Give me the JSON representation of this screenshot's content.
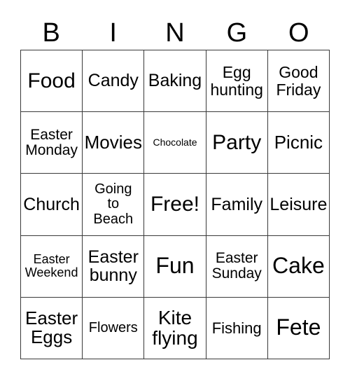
{
  "card": {
    "background_color": "#ffffff",
    "text_color": "#000000",
    "border_color": "#3a3a3a",
    "columns": 5,
    "rows": 5
  },
  "header": {
    "letters": [
      "B",
      "I",
      "N",
      "G",
      "O"
    ]
  },
  "grid": {
    "rows": [
      [
        {
          "text": "Food",
          "size": "fs-30"
        },
        {
          "text": "Candy",
          "size": "fs-25"
        },
        {
          "text": "Baking",
          "size": "fs-25"
        },
        {
          "text": "Egg\nhunting",
          "size": "fs-23"
        },
        {
          "text": "Good\nFriday",
          "size": "fs-23"
        }
      ],
      [
        {
          "text": "Easter\nMonday",
          "size": "fs-21"
        },
        {
          "text": "Movies",
          "size": "fs-26"
        },
        {
          "text": "Chocolate",
          "size": "fs-14"
        },
        {
          "text": "Party",
          "size": "fs-30"
        },
        {
          "text": "Picnic",
          "size": "fs-26"
        }
      ],
      [
        {
          "text": "Church",
          "size": "fs-25"
        },
        {
          "text": "Going\nto\nBeach",
          "size": "fs-20"
        },
        {
          "text": "Free!",
          "size": "fs-30"
        },
        {
          "text": "Family",
          "size": "fs-25"
        },
        {
          "text": "Leisure",
          "size": "fs-25"
        }
      ],
      [
        {
          "text": "Easter\nWeekend",
          "size": "fs-18"
        },
        {
          "text": "Easter\nbunny",
          "size": "fs-25"
        },
        {
          "text": "Fun",
          "size": "fs-32"
        },
        {
          "text": "Easter\nSunday",
          "size": "fs-21"
        },
        {
          "text": "Cake",
          "size": "fs-32"
        }
      ],
      [
        {
          "text": "Easter\nEggs",
          "size": "fs-26"
        },
        {
          "text": "Flowers",
          "size": "fs-20"
        },
        {
          "text": "Kite\nflying",
          "size": "fs-28"
        },
        {
          "text": "Fishing",
          "size": "fs-22"
        },
        {
          "text": "Fete",
          "size": "fs-32"
        }
      ]
    ]
  }
}
